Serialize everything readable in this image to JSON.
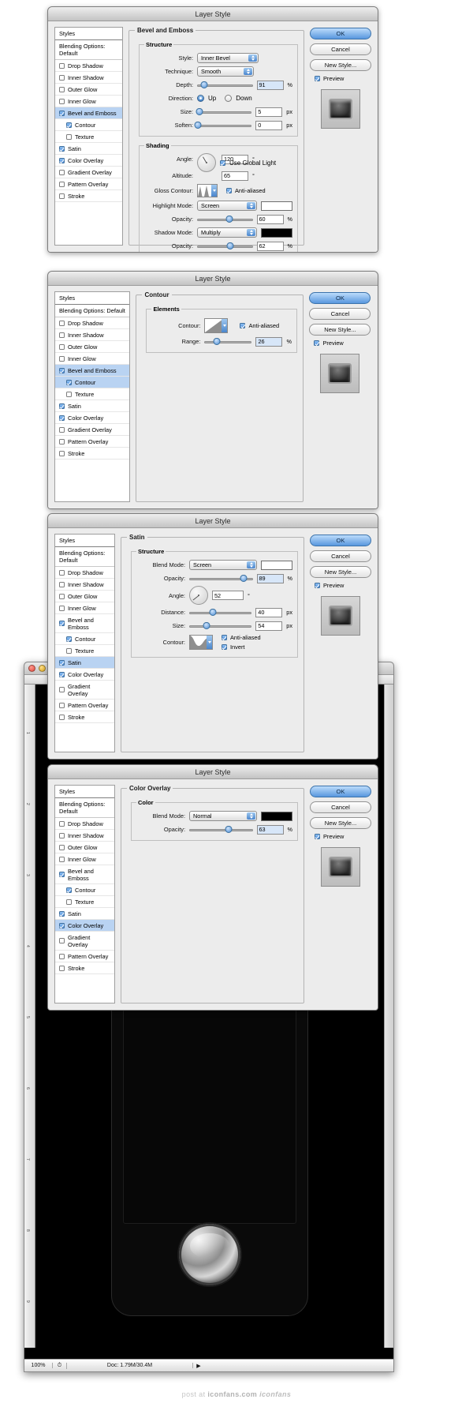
{
  "window": {
    "title": "Layer Style",
    "statusbar": {
      "zoom": "100%",
      "doc": "Doc: 1.79M/30.4M",
      "arrow": "▶"
    },
    "ruler_ticks": [
      "1",
      "2",
      "3",
      "4",
      "5",
      "6",
      "7",
      "8",
      "9"
    ]
  },
  "credit": {
    "prefix": "post at ",
    "site": "iconfans.com",
    "logo": "iconfans"
  },
  "buttons": {
    "ok": "OK",
    "cancel": "Cancel",
    "new_style": "New Style...",
    "preview": "Preview"
  },
  "styles_list": {
    "header": "Styles",
    "blending": "Blending Options: Default",
    "items": [
      {
        "label": "Drop Shadow",
        "checked": false,
        "sub": false
      },
      {
        "label": "Inner Shadow",
        "checked": false,
        "sub": false
      },
      {
        "label": "Outer Glow",
        "checked": false,
        "sub": false
      },
      {
        "label": "Inner Glow",
        "checked": false,
        "sub": false
      },
      {
        "label": "Bevel and Emboss",
        "checked": true,
        "sub": false
      },
      {
        "label": "Contour",
        "checked": true,
        "sub": true
      },
      {
        "label": "Texture",
        "checked": false,
        "sub": true
      },
      {
        "label": "Satin",
        "checked": true,
        "sub": false
      },
      {
        "label": "Color Overlay",
        "checked": true,
        "sub": false
      },
      {
        "label": "Gradient Overlay",
        "checked": false,
        "sub": false
      },
      {
        "label": "Pattern Overlay",
        "checked": false,
        "sub": false
      },
      {
        "label": "Stroke",
        "checked": false,
        "sub": false
      }
    ]
  },
  "dialog1": {
    "title": "Layer Style",
    "selected_item": "Bevel and Emboss",
    "group": "Bevel and Emboss",
    "subgroup_structure": "Structure",
    "subgroup_shading": "Shading",
    "style_label": "Style:",
    "style_value": "Inner Bevel",
    "technique_label": "Technique:",
    "technique_value": "Smooth",
    "depth_label": "Depth:",
    "depth_value": "91",
    "depth_unit": "%",
    "direction_label": "Direction:",
    "direction_up": "Up",
    "direction_down": "Down",
    "size_label": "Size:",
    "size_value": "5",
    "size_unit": "px",
    "soften_label": "Soften:",
    "soften_value": "0",
    "soften_unit": "px",
    "angle_label": "Angle:",
    "angle_value": "120",
    "angle_unit": "°",
    "use_global_light": "Use Global Light",
    "altitude_label": "Altitude:",
    "altitude_value": "65",
    "altitude_unit": "°",
    "gloss_contour_label": "Gloss Contour:",
    "anti_aliased": "Anti-aliased",
    "highlight_mode_label": "Highlight Mode:",
    "highlight_mode_value": "Screen",
    "highlight_color": "#ffffff",
    "highlight_opacity_label": "Opacity:",
    "highlight_opacity_value": "60",
    "highlight_opacity_unit": "%",
    "shadow_mode_label": "Shadow Mode:",
    "shadow_mode_value": "Multiply",
    "shadow_color": "#000000",
    "shadow_opacity_label": "Opacity:",
    "shadow_opacity_value": "62",
    "shadow_opacity_unit": "%"
  },
  "dialog2": {
    "title": "Layer Style",
    "selected_item": "Contour",
    "group": "Contour",
    "subgroup": "Elements",
    "contour_label": "Contour:",
    "anti_aliased": "Anti-aliased",
    "range_label": "Range:",
    "range_value": "26",
    "range_unit": "%"
  },
  "dialog3": {
    "title": "Layer Style",
    "selected_item": "Satin",
    "group": "Satin",
    "subgroup": "Structure",
    "blend_mode_label": "Blend Mode:",
    "blend_mode_value": "Screen",
    "blend_color": "#ffffff",
    "opacity_label": "Opacity:",
    "opacity_value": "89",
    "opacity_unit": "%",
    "angle_label": "Angle:",
    "angle_value": "52",
    "angle_unit": "°",
    "distance_label": "Distance:",
    "distance_value": "40",
    "distance_unit": "px",
    "size_label": "Size:",
    "size_value": "54",
    "size_unit": "px",
    "contour_label": "Contour:",
    "anti_aliased": "Anti-aliased",
    "invert": "Invert"
  },
  "dialog4": {
    "title": "Layer Style",
    "selected_item": "Color Overlay",
    "group": "Color Overlay",
    "subgroup": "Color",
    "blend_mode_label": "Blend Mode:",
    "blend_mode_value": "Normal",
    "blend_color": "#000000",
    "opacity_label": "Opacity:",
    "opacity_value": "63",
    "opacity_unit": "%"
  }
}
